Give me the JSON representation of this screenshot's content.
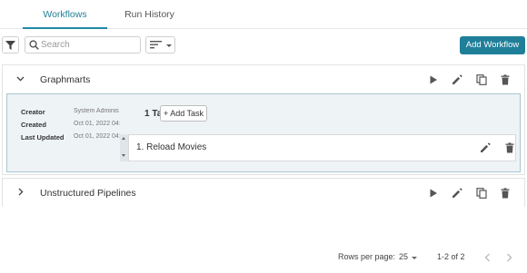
{
  "tabs": [
    {
      "label": "Workflows",
      "active": true
    },
    {
      "label": "Run History",
      "active": false
    }
  ],
  "toolbar": {
    "search_placeholder": "Search",
    "search_value": "",
    "add_workflow_label": "Add Workflow"
  },
  "workflows": [
    {
      "title": "Graphmarts",
      "expanded": true,
      "details": {
        "creator_label": "Creator",
        "creator_value": "System Adminis",
        "created_label": "Created",
        "created_value": "Oct 01, 2022 04:",
        "updated_label": "Last Updated",
        "updated_value": "Oct 01, 2022 04:",
        "tasks_count": "1 Tasks",
        "add_task_label": "+ Add Task",
        "tasks": [
          {
            "name": "1. Reload Movies"
          }
        ]
      }
    },
    {
      "title": "Unstructured Pipelines",
      "expanded": false
    }
  ],
  "pagination": {
    "rows_per_page_label": "Rows per page:",
    "rows_per_page_value": "25",
    "range": "1-2 of 2"
  },
  "colors": {
    "accent": "#1f7f99",
    "details_bg": "#eef3f6",
    "details_border": "#aac6d3"
  }
}
